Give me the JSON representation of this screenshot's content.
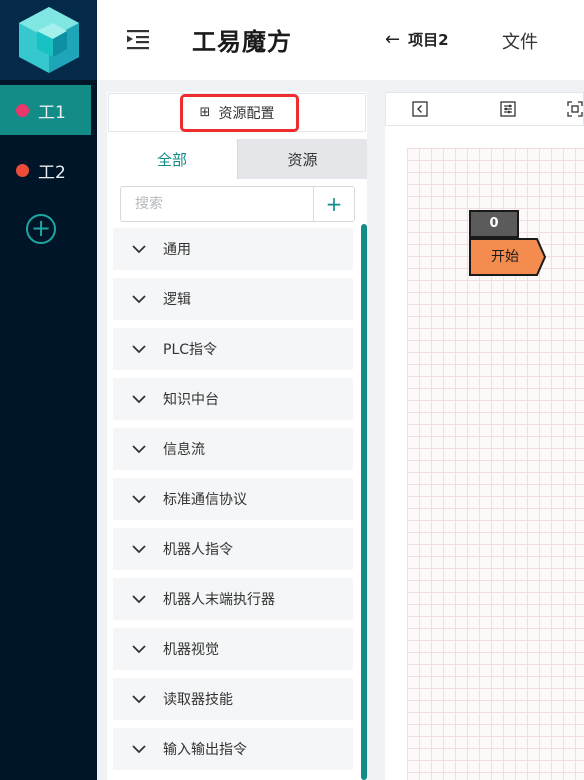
{
  "workspaces": [
    {
      "label": "工1",
      "dot_color": "#e8386a",
      "active": true
    },
    {
      "label": "工2",
      "dot_color": "#ee4b39",
      "active": false
    }
  ],
  "add_workspace": "+",
  "header": {
    "title": "工易魔方",
    "back_label": "项目2",
    "back_arrow": "←",
    "file_menu": "文件"
  },
  "panel": {
    "resource_config": "资源配置",
    "resource_icon": "⊞",
    "tabs": {
      "all": "全部",
      "resource": "资源"
    },
    "search_placeholder": "搜索",
    "add_label": "+",
    "categories": [
      "通用",
      "逻辑",
      "PLC指令",
      "知识中台",
      "信息流",
      "标准通信协议",
      "机器人指令",
      "机器人末端执行器",
      "机器视觉",
      "读取器技能",
      "输入输出指令"
    ]
  },
  "canvas": {
    "node_badge": "0",
    "start_node": "开始"
  },
  "colors": {
    "accent": "#138b87",
    "rail_bg": "#001628",
    "highlight": "#ee2e2e",
    "start_node": "#f58c4f"
  }
}
